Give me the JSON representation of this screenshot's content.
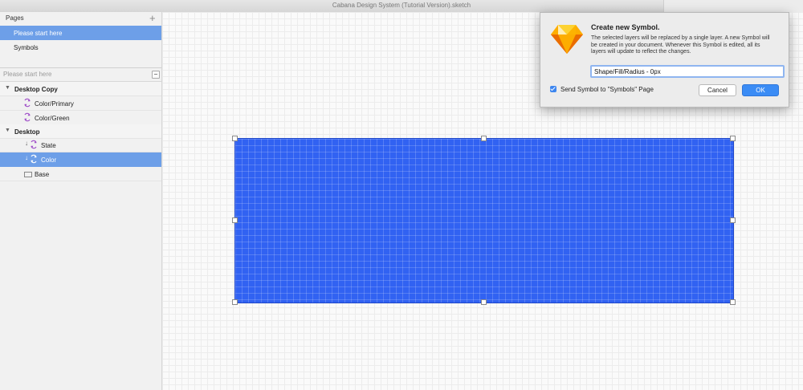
{
  "window": {
    "title": "Cabana Design System (Tutorial Version).sketch"
  },
  "sidebar": {
    "pages_label": "Pages",
    "add_page_icon": "plus-icon",
    "pages": [
      {
        "label": "Please start here",
        "selected": true
      },
      {
        "label": "Symbols",
        "selected": false
      }
    ],
    "filter_placeholder": "Please start here",
    "layers": [
      {
        "label": "Desktop Copy",
        "kind": "group"
      },
      {
        "label": "Color/Primary",
        "kind": "symbol"
      },
      {
        "label": "Color/Green",
        "kind": "symbol"
      },
      {
        "label": "Desktop",
        "kind": "group"
      },
      {
        "label": "State",
        "kind": "symbol-override"
      },
      {
        "label": "Color",
        "kind": "symbol-override",
        "selected": true
      },
      {
        "label": "Base",
        "kind": "rectangle"
      }
    ]
  },
  "canvas": {
    "shape_fill": "#3162f2"
  },
  "dialog": {
    "title": "Create new Symbol.",
    "message": "The selected layers will be replaced by a single layer. A new Symbol will be created in your document. Whenever this Symbol is edited, all its layers will update to reflect the changes.",
    "name_value": "Shape/Fill/Radius - 0px",
    "checkbox_label": "Send Symbol to \"Symbols\" Page",
    "checkbox_checked": true,
    "cancel_label": "Cancel",
    "ok_label": "OK",
    "app_icon": "sketch-diamond-icon"
  }
}
